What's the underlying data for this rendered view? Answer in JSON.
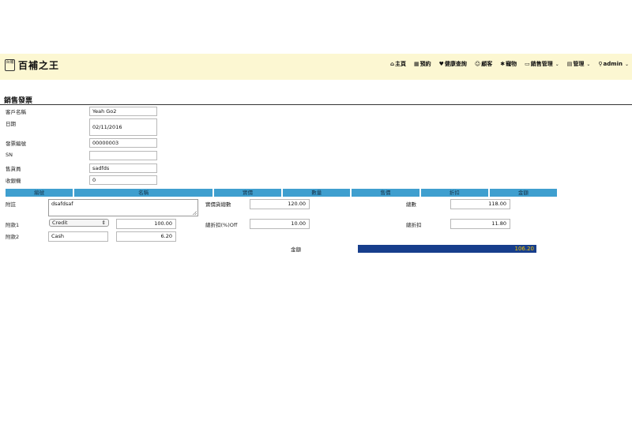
{
  "brand": {
    "seal_text": "百補",
    "name": "百補之王"
  },
  "nav": [
    {
      "icon": "home-icon",
      "glyph": "⌂",
      "label": "主頁"
    },
    {
      "icon": "calendar-icon",
      "glyph": "▦",
      "label": "預約"
    },
    {
      "icon": "heart-icon",
      "glyph": "♥",
      "label": "健康查詢"
    },
    {
      "icon": "users-icon",
      "glyph": "☺",
      "label": "顧客"
    },
    {
      "icon": "star-icon",
      "glyph": "✱",
      "label": "寵物"
    },
    {
      "icon": "card-icon",
      "glyph": "▭",
      "label": "銷售管理"
    },
    {
      "icon": "chart-icon",
      "glyph": "▤",
      "label": "管理"
    },
    {
      "icon": "user-icon",
      "glyph": "⚲",
      "label": "admin"
    }
  ],
  "page_title": "銷售發票",
  "form": {
    "customer_label": "客戶名稱",
    "customer_value": "Yeah Go2",
    "date_label": "日期",
    "date_value": "02/11/2016",
    "invoice_label": "發票編號",
    "invoice_value": "00000003",
    "sn_label": "SN",
    "sn_value": "",
    "salesperson_label": "售貨員",
    "salesperson_value": "sadfds",
    "cashier_label": "收銀機",
    "cashier_value": "0"
  },
  "table_headers": [
    "編號",
    "名稱",
    "實價",
    "數量",
    "售價",
    "折扣",
    "金額"
  ],
  "summary": {
    "note_label": "附註",
    "note_value": "dsafdsaf",
    "pay1_label": "附款1",
    "pay1_method": "Credit",
    "pay1_amount": "100.00",
    "pay2_label": "附款2",
    "pay2_method": "Cash",
    "pay2_amount": "6.20",
    "actual_total_label": "實價貨總數",
    "actual_total_value": "120.00",
    "discount_pct_label": "總折扣(%)Off",
    "discount_pct_value": "10.00",
    "total_label": "總數",
    "total_value": "118.00",
    "discount_label": "總折扣",
    "discount_value": "11.80",
    "amount_label": "金額",
    "amount_value": "106.20"
  },
  "colors": {
    "navbar_bg": "#fcf7d2",
    "header_blue": "#3f9fcf",
    "total_bg": "#173e8c",
    "total_text": "#f5c400"
  }
}
